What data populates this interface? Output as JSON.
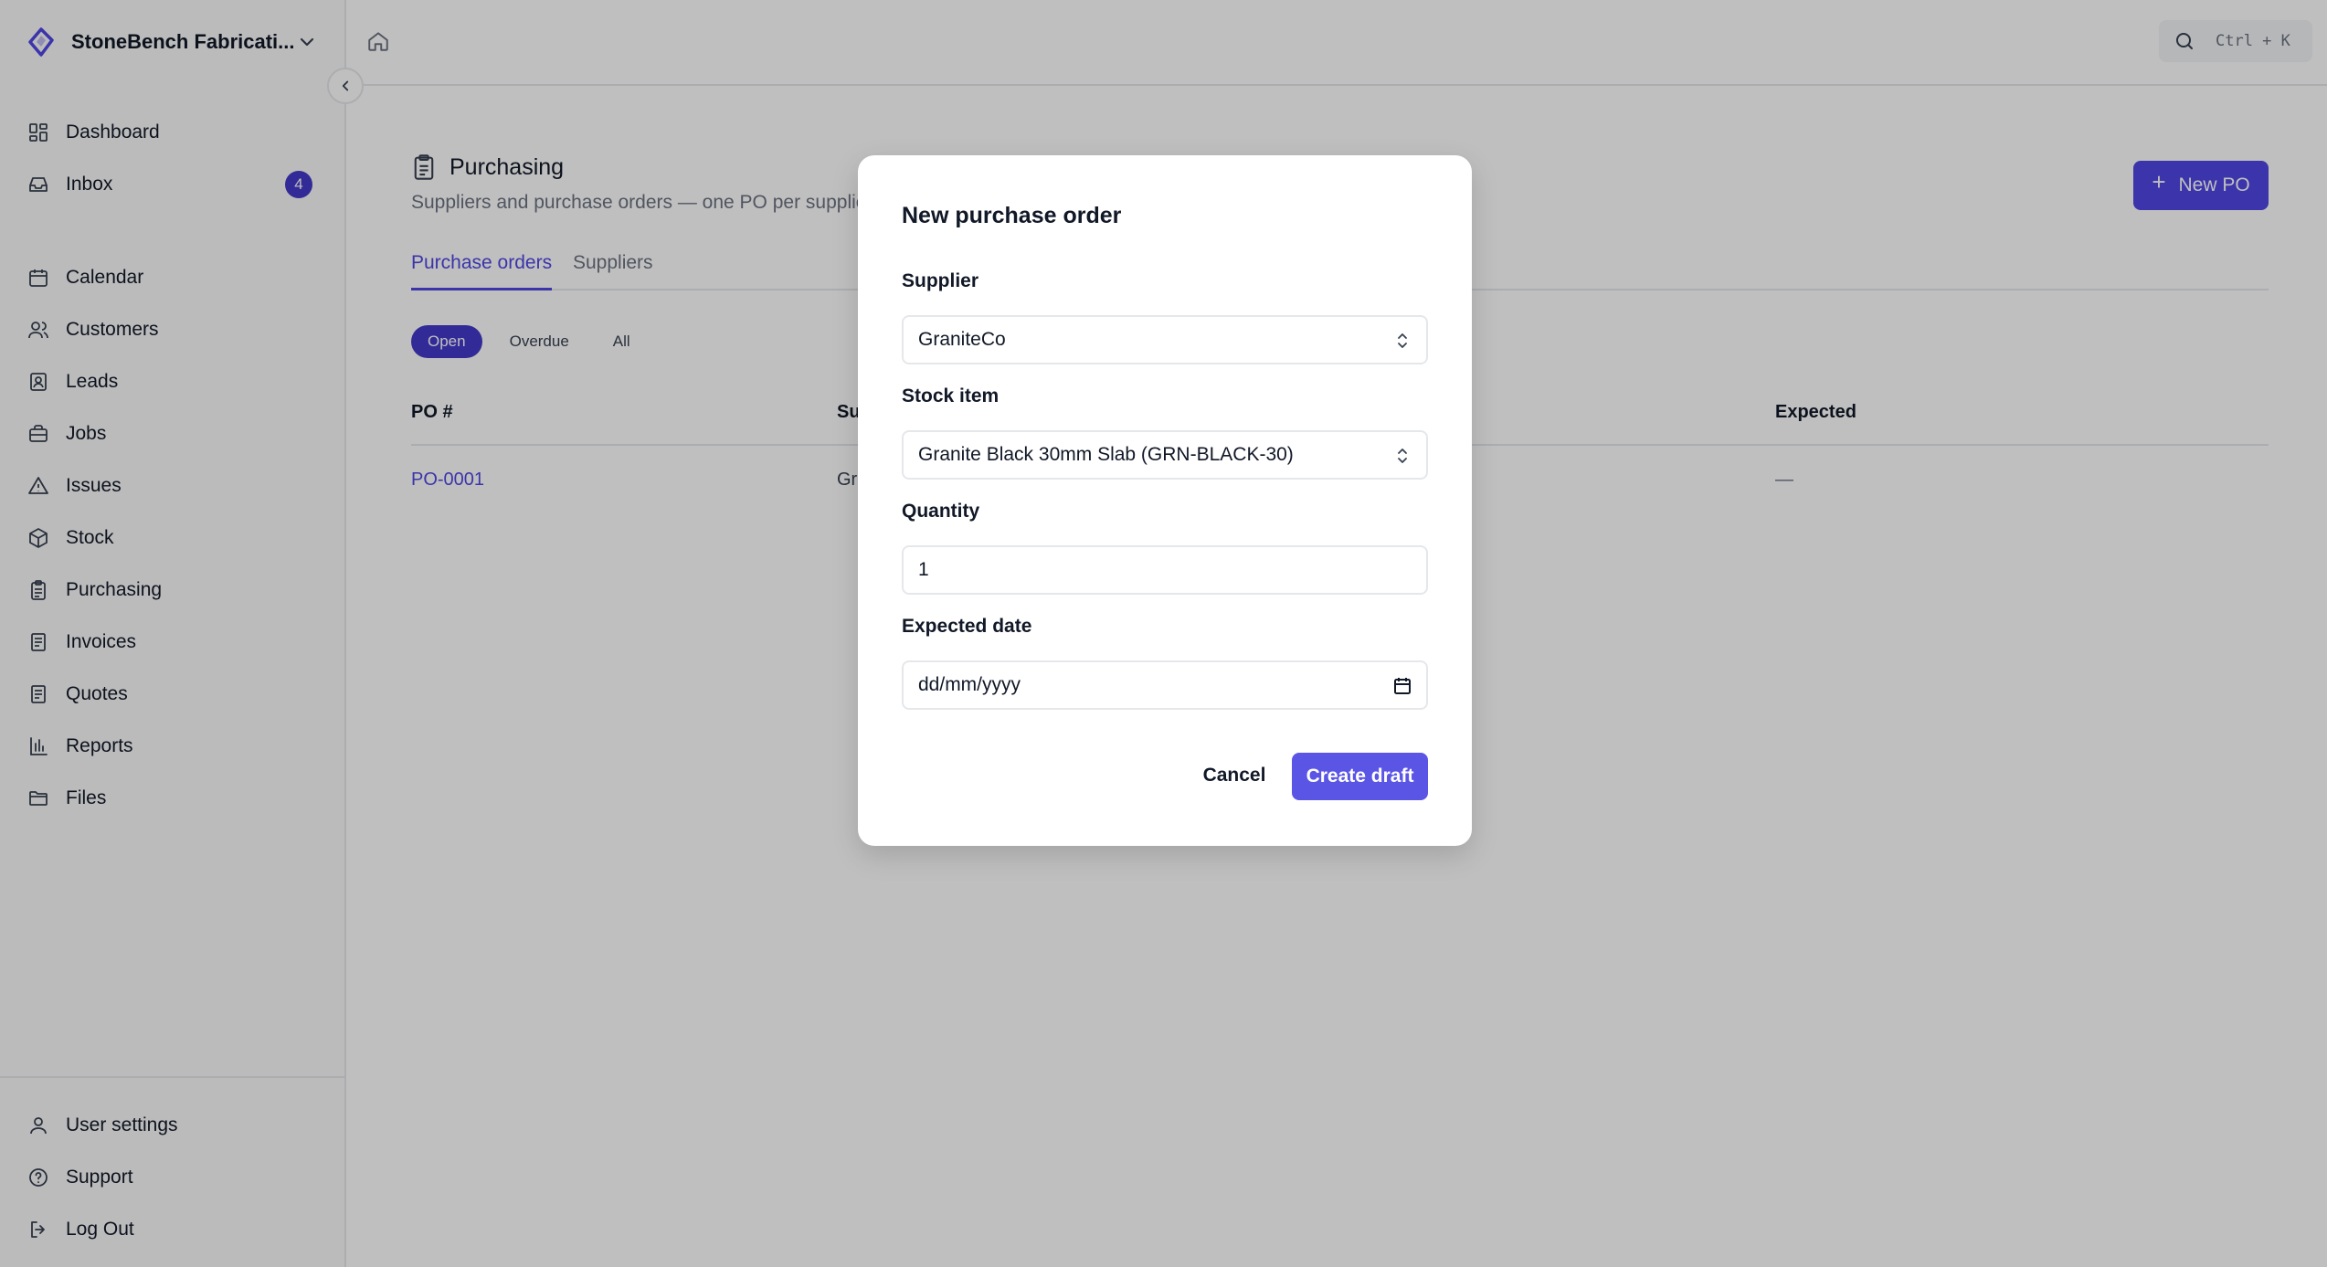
{
  "org": {
    "name": "StoneBench Fabricati..."
  },
  "nav": {
    "primary": [
      {
        "label": "Dashboard",
        "icon": "dashboard-icon"
      },
      {
        "label": "Inbox",
        "icon": "inbox-icon",
        "badge": "4"
      }
    ],
    "secondary": [
      {
        "label": "Calendar",
        "icon": "calendar-icon"
      },
      {
        "label": "Customers",
        "icon": "customers-icon"
      },
      {
        "label": "Leads",
        "icon": "leads-icon"
      },
      {
        "label": "Jobs",
        "icon": "jobs-icon"
      },
      {
        "label": "Issues",
        "icon": "warning-icon"
      },
      {
        "label": "Stock",
        "icon": "box-icon"
      },
      {
        "label": "Purchasing",
        "icon": "clipboard-icon"
      },
      {
        "label": "Invoices",
        "icon": "invoice-icon"
      },
      {
        "label": "Quotes",
        "icon": "quote-icon"
      },
      {
        "label": "Reports",
        "icon": "chart-icon"
      },
      {
        "label": "Files",
        "icon": "folder-icon"
      }
    ],
    "bottom": [
      {
        "label": "User settings",
        "icon": "user-icon"
      },
      {
        "label": "Support",
        "icon": "help-icon"
      },
      {
        "label": "Log Out",
        "icon": "logout-icon"
      }
    ]
  },
  "topbar": {
    "search_shortcut": "Ctrl + K"
  },
  "page": {
    "title": "Purchasing",
    "subtitle": "Suppliers and purchase orders — one PO per supplie",
    "new_button": "New PO",
    "tabs": [
      "Purchase orders",
      "Suppliers"
    ],
    "active_tab": "Purchase orders",
    "filters": [
      "Open",
      "Overdue",
      "All"
    ],
    "active_filter": "Open",
    "table": {
      "headers": {
        "po": "PO #",
        "supplier": "Su",
        "expected": "Expected"
      },
      "rows": [
        {
          "po": "PO-0001",
          "supplier": "Gr",
          "expected": "—"
        }
      ]
    }
  },
  "modal": {
    "title": "New purchase order",
    "supplier_label": "Supplier",
    "supplier_value": "GraniteCo",
    "stock_label": "Stock item",
    "stock_value": "Granite Black 30mm Slab (GRN-BLACK-30)",
    "quantity_label": "Quantity",
    "quantity_value": "1",
    "date_label": "Expected date",
    "date_placeholder": "dd/mm/yyyy",
    "cancel": "Cancel",
    "create": "Create draft"
  },
  "colors": {
    "accent": "#4f46e5",
    "badge": "#4338ca"
  }
}
